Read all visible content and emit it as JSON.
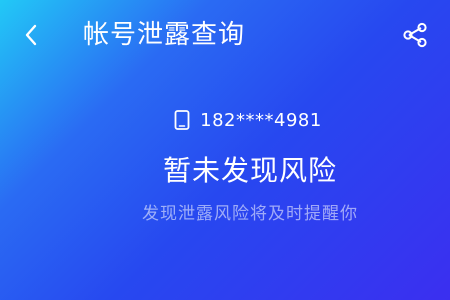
{
  "header": {
    "title": "帐号泄露查询",
    "back_icon": "chevron-left-icon",
    "share_icon": "share-icon"
  },
  "account": {
    "phone_icon": "phone-icon",
    "phone_number": "182****4981"
  },
  "result": {
    "status": "暂未发现风险",
    "subtitle": "发现泄露风险将及时提醒你"
  },
  "colors": {
    "gradient_start": "#22c9f6",
    "gradient_mid": "#2748f0",
    "gradient_end": "#3b2ff0",
    "text": "#ffffff"
  }
}
